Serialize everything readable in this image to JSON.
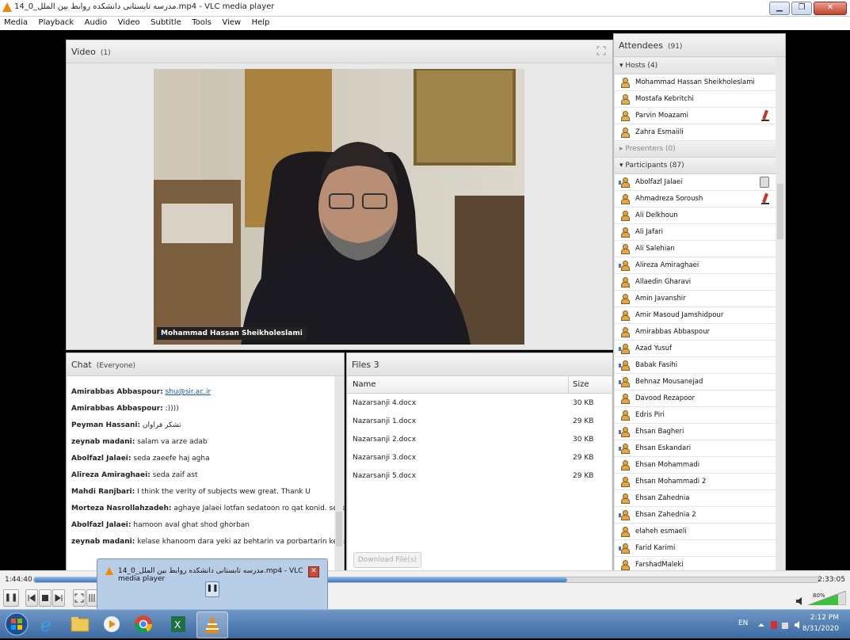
{
  "window": {
    "title": "مدرسه تابستانی دانشکده روابط بین الملل_0_14.mp4 - VLC media player",
    "minimize": "▁",
    "restore": "❐",
    "close": "✕"
  },
  "menu": [
    "Media",
    "Playback",
    "Audio",
    "Video",
    "Subtitle",
    "Tools",
    "View",
    "Help"
  ],
  "video_pod": {
    "title": "Video",
    "count": "(1)",
    "speaker_label": "Mohammad Hassan Sheikholeslami"
  },
  "chat_pod": {
    "title": "Chat",
    "scope": "(Everyone)",
    "messages": [
      {
        "name": "Amirabbas Abbaspour:",
        "text": "",
        "link": "shu@sir.ac.ir"
      },
      {
        "name": "Amirabbas Abbaspour:",
        "text": ":))))",
        "link": ""
      },
      {
        "name": "Peyman Hassani:",
        "text": "تشکر فراوان",
        "link": ""
      },
      {
        "name": "zeynab madani:",
        "text": "salam va arze adab",
        "link": ""
      },
      {
        "name": "Abolfazl Jalaei:",
        "text": "seda zaeefe haj agha",
        "link": ""
      },
      {
        "name": "Alireza Amiraghaei:",
        "text": "seda zaif ast",
        "link": ""
      },
      {
        "name": "Mahdi Ranjbari:",
        "text": "I think the verity of subjects wew great. Thank U",
        "link": ""
      },
      {
        "name": "Morteza Nasrollahzadeh:",
        "text": "aghaye Jalaei lotfan sedatoon ro qat konid. sepas",
        "link": ""
      },
      {
        "name": "Abolfazl Jalaei:",
        "text": "hamoon aval ghat shod ghorban",
        "link": ""
      },
      {
        "name": "zeynab madani:",
        "text": "kelase khanoom dara yeki az behtarin va porbartarin kelasha bood",
        "link": ""
      }
    ]
  },
  "files_pod": {
    "title": "Files 3",
    "col_name": "Name",
    "col_size": "Size",
    "files": [
      {
        "name": "Nazarsanji 4.docx",
        "size": "30 KB"
      },
      {
        "name": "Nazarsanji 1.docx",
        "size": "29 KB"
      },
      {
        "name": "Nazarsanji 2.docx",
        "size": "30 KB"
      },
      {
        "name": "Nazarsanji 3.docx",
        "size": "29 KB"
      },
      {
        "name": "Nazarsanji 5.docx",
        "size": "29 KB"
      }
    ],
    "download_button": "Download File(s)"
  },
  "attendees_pod": {
    "title": "Attendees",
    "count": "(91)",
    "hosts_header": "Hosts (4)",
    "hosts": [
      {
        "name": "Mohammad Hassan Sheikholeslami",
        "status": ""
      },
      {
        "name": "Mostafa Kebritchi",
        "status": ""
      },
      {
        "name": "Parvin Moazami",
        "status": "mic"
      },
      {
        "name": "Zahra Esmaiili",
        "status": ""
      }
    ],
    "presenters_header": "Presenters (0)",
    "participants_header": "Participants (87)",
    "participants": [
      {
        "name": "Abolfazl Jalaei",
        "status": "phone",
        "speaker": true
      },
      {
        "name": "Ahmadreza Soroush",
        "status": "mic",
        "speaker": false
      },
      {
        "name": "Ali Delkhoun",
        "status": "",
        "speaker": false
      },
      {
        "name": "Ali Jafari",
        "status": "",
        "speaker": false
      },
      {
        "name": "Ali Salehian",
        "status": "",
        "speaker": false
      },
      {
        "name": "Alireza Amiraghaei",
        "status": "",
        "speaker": true
      },
      {
        "name": "Allaedin Gharavi",
        "status": "",
        "speaker": false
      },
      {
        "name": "Amin Javanshir",
        "status": "",
        "speaker": false
      },
      {
        "name": "Amir Masoud Jamshidpour",
        "status": "",
        "speaker": false
      },
      {
        "name": "Amirabbas Abbaspour",
        "status": "",
        "speaker": false
      },
      {
        "name": "Azad Yusuf",
        "status": "",
        "speaker": true
      },
      {
        "name": "Babak Fasihi",
        "status": "",
        "speaker": true
      },
      {
        "name": "Behnaz Mousanejad",
        "status": "",
        "speaker": true
      },
      {
        "name": "Davood Rezapoor",
        "status": "",
        "speaker": false
      },
      {
        "name": "Edris Piri",
        "status": "",
        "speaker": false
      },
      {
        "name": "Ehsan Bagheri",
        "status": "",
        "speaker": true
      },
      {
        "name": "Ehsan Eskandari",
        "status": "",
        "speaker": true
      },
      {
        "name": "Ehsan Mohammadi",
        "status": "",
        "speaker": false
      },
      {
        "name": "Ehsan Mohammadi 2",
        "status": "",
        "speaker": false
      },
      {
        "name": "Ehsan Zahednia",
        "status": "",
        "speaker": false
      },
      {
        "name": "Ehsan Zahednia 2",
        "status": "",
        "speaker": true
      },
      {
        "name": "elaheh esmaeli",
        "status": "",
        "speaker": false
      },
      {
        "name": "Farid Karimi",
        "status": "",
        "speaker": true
      },
      {
        "name": "FarshadMaleki",
        "status": "",
        "speaker": false
      }
    ]
  },
  "player": {
    "elapsed": "1:44:40",
    "total": "2:33:05",
    "progress": 0.68,
    "volume": "80%",
    "pause_glyph": "❚❚"
  },
  "popup": {
    "title": "مدرسه تابستانی دانشکده روابط بین الملل_0_14.mp4 - VLC media player",
    "close": "✕",
    "pause_glyph": "❚❚"
  },
  "taskbar": {
    "lang": "EN",
    "time": "2:12 PM",
    "date": "8/31/2020",
    "apps": [
      "start-orb",
      "internet-explorer",
      "file-explorer",
      "media-player",
      "chrome",
      "excel",
      "vlc"
    ]
  }
}
